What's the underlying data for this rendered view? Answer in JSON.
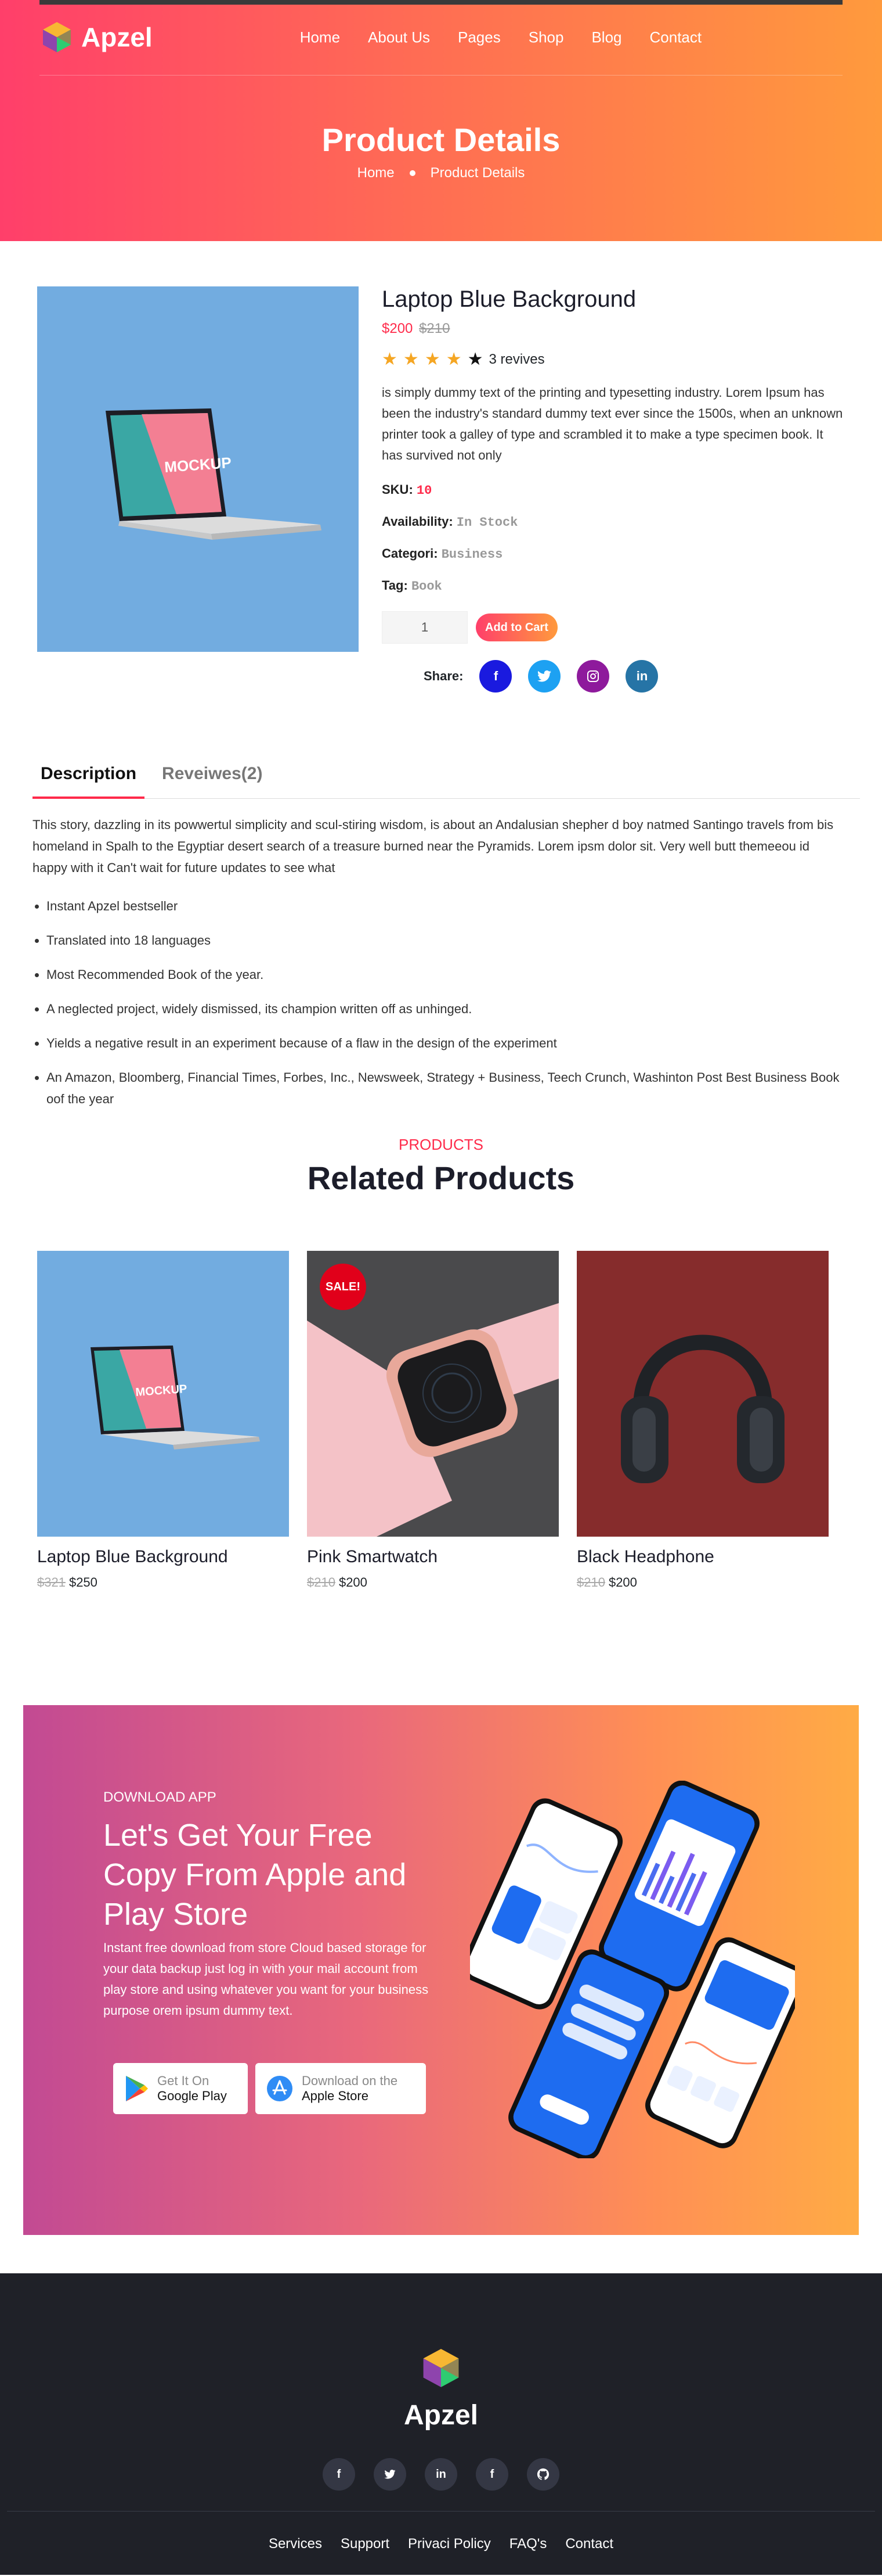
{
  "brand": {
    "name": "Apzel"
  },
  "nav": {
    "items": [
      "Home",
      "About Us",
      "Pages",
      "Shop",
      "Blog",
      "Contact"
    ]
  },
  "hero": {
    "title": "Product Details",
    "crumb_home": "Home",
    "crumb_current": "Product Details"
  },
  "product": {
    "title": "Laptop Blue Background",
    "price": "$200",
    "old_price": "$210",
    "rating": 4,
    "reviews": "3 revives",
    "description": "is simply dummy text of the printing and typesetting industry. Lorem Ipsum has been the industry's standard dummy text ever since the 1500s, when an unknown printer took a galley of type and scrambled it to make a type specimen book. It has survived not only",
    "sku_label": "SKU:",
    "sku": "10",
    "availability_label": "Availability:",
    "availability": "In Stock",
    "category_label": "Categori:",
    "category": "Business",
    "tag_label": "Tag:",
    "tag": "Book",
    "quantity": "1",
    "add_to_cart": "Add to Cart",
    "share_label": "Share:",
    "mockup_text": "MOCKUP"
  },
  "tabs": {
    "description": "Description",
    "reviews": "Reveiwes(2)"
  },
  "long_description": "This story, dazzling in its powwertul simplicity and scul-stiring wisdom, is about an Andalusian shepher d boy natmed Santingo travels from bis homeland in Spalh to the Egyptiar desert search of a treasure burned near the Pyramids. Lorem ipsm dolor sit. Very well butt themeeou id happy with it Can't wait for future updates to see what",
  "bullets": [
    "Instant Apzel bestseller",
    "Translated into 18 languages",
    "Most Recommended Book of the year.",
    "A neglected project, widely dismissed, its champion written off as unhinged.",
    "Yields a negative result in an experiment because of a flaw in the design of the experiment",
    "An Amazon, Bloomberg, Financial Times, Forbes, Inc., Newsweek, Strategy + Business, Teech Crunch, Washinton Post Best Business Book oof the year"
  ],
  "related": {
    "eyebrow": "PRODUCTS",
    "title": "Related Products",
    "items": [
      {
        "name": "Laptop Blue Background",
        "old_price": "$321",
        "price": "$250"
      },
      {
        "name": "Pink Smartwatch",
        "old_price": "$210",
        "price": "$200",
        "badge": "SALE!"
      },
      {
        "name": "Black Headphone",
        "old_price": "$210",
        "price": "$200"
      }
    ]
  },
  "app": {
    "eyebrow": "DOWNLOAD APP",
    "title": "Let's Get Your Free Copy From Apple and Play Store",
    "text": "Instant free download from store Cloud based storage for your data backup just log in with your mail account from play store and using whatever you want for your business purpose orem ipsum dummy text.",
    "google_small": "Get It On",
    "google_big": "Google Play",
    "apple_small": "Download on the",
    "apple_big": "Apple Store"
  },
  "footer": {
    "name": "Apzel",
    "links": [
      "Services",
      "Support",
      "Privaci Policy",
      "FAQ's",
      "Contact"
    ]
  },
  "colors": {
    "accent": "#ff2a4a",
    "gradient_start": "#ff3f6a",
    "gradient_end": "#ff9a3d",
    "footer_bg": "#1f2128"
  }
}
